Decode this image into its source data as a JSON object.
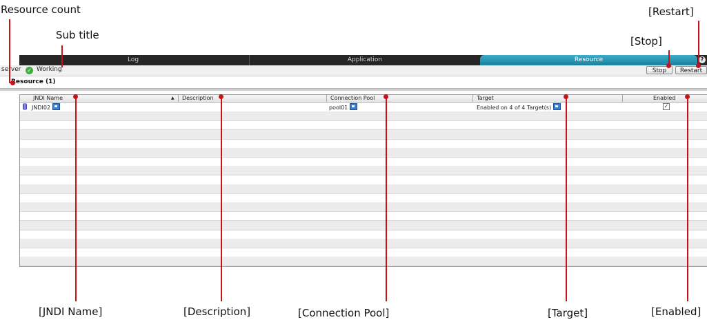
{
  "callouts": {
    "resource_count": "Resource count",
    "sub_title": "Sub title",
    "restart": "[Restart]",
    "stop": "[Stop]",
    "jndi_name": "[JNDI Name]",
    "description": "[Description]",
    "connection_pool": "[Connection Pool]",
    "target": "[Target]",
    "enabled": "[Enabled]"
  },
  "tabs": [
    {
      "label": "Log",
      "active": false
    },
    {
      "label": "Application",
      "active": false
    },
    {
      "label": "Resource",
      "active": true
    }
  ],
  "help_icon": "?",
  "subtitle": {
    "server": "server",
    "status_icon": "check-circle-icon",
    "status": "Working"
  },
  "buttons": {
    "stop": "Stop",
    "restart": "Restart"
  },
  "section": {
    "title": "Resource (1)"
  },
  "table": {
    "columns": [
      {
        "label": "JNDI Name",
        "sort": "▲"
      },
      {
        "label": "Description"
      },
      {
        "label": "Connection Pool"
      },
      {
        "label": "Target"
      },
      {
        "label": "Enabled"
      }
    ],
    "rows": [
      {
        "jndi_name": "JNDI02",
        "description": "",
        "connection_pool": "pool01",
        "target": "Enabled on 4 of 4 Target(s)",
        "enabled": true
      }
    ]
  },
  "colors": {
    "accent_red": "#c8101a",
    "active_tab": "#1b7f9e",
    "tab_bar": "#262626"
  }
}
